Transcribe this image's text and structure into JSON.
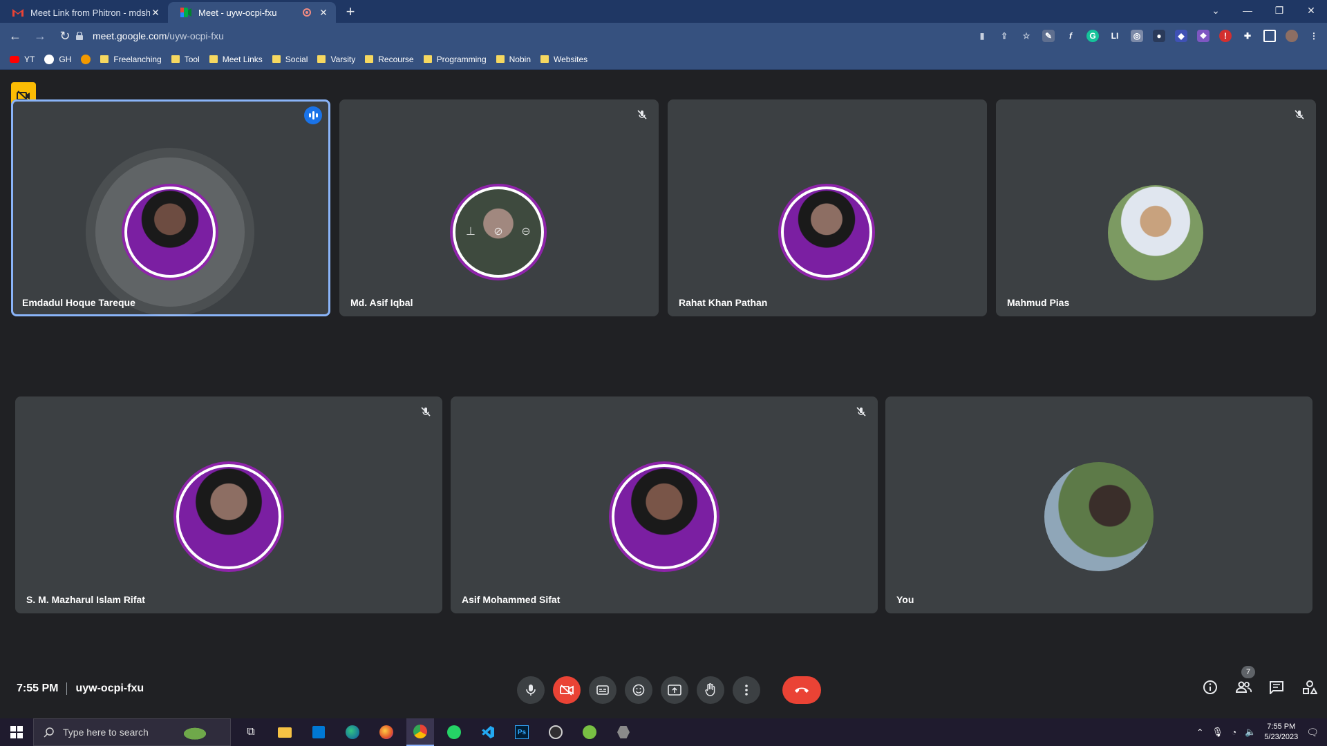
{
  "browser": {
    "tabs": [
      {
        "title": "Meet Link from Phitron - mdshah",
        "icon": "gmail-icon",
        "active": false
      },
      {
        "title": "Meet - uyw-ocpi-fxu",
        "icon": "meet-icon",
        "active": true
      }
    ],
    "url_host": "meet.google.com",
    "url_path": "/uyw-ocpi-fxu",
    "bookmarks": [
      "YT",
      "GH",
      "",
      "Freelanching",
      "Tool",
      "Meet Links",
      "Social",
      "Varsity",
      "Recourse",
      "Programming",
      "Nobin",
      "Websites"
    ]
  },
  "meet": {
    "participants": [
      {
        "name": "Emdadul Hoque Tareque",
        "speaking": true,
        "muted": false,
        "avatar_color": "#7b1fa2"
      },
      {
        "name": "Md. Asif Iqbal",
        "speaking": false,
        "muted": true,
        "avatar_color": "#5a6a5a"
      },
      {
        "name": "Rahat Khan Pathan",
        "speaking": false,
        "muted": false,
        "avatar_color": "#7b1fa2"
      },
      {
        "name": "Mahmud Pias",
        "speaking": false,
        "muted": true,
        "avatar_color": "#9db58c"
      },
      {
        "name": "S. M. Mazharul Islam Rifat",
        "speaking": false,
        "muted": true,
        "avatar_color": "#7b1fa2"
      },
      {
        "name": "Asif Mohammed Sifat",
        "speaking": false,
        "muted": true,
        "avatar_color": "#7b1fa2"
      },
      {
        "name": "You",
        "speaking": false,
        "muted": false,
        "avatar_color": "#6d8a4f"
      }
    ],
    "time": "7:55 PM",
    "meeting_code": "uyw-ocpi-fxu",
    "people_count": "7"
  },
  "taskbar": {
    "search_placeholder": "Type here to search",
    "time": "7:55 PM",
    "date": "5/23/2023"
  },
  "colors": {
    "accent": "#8ab4f8",
    "hangup": "#ea4335",
    "tile": "#3c4043",
    "background": "#202124",
    "brand_ring": "#8e24aa"
  }
}
